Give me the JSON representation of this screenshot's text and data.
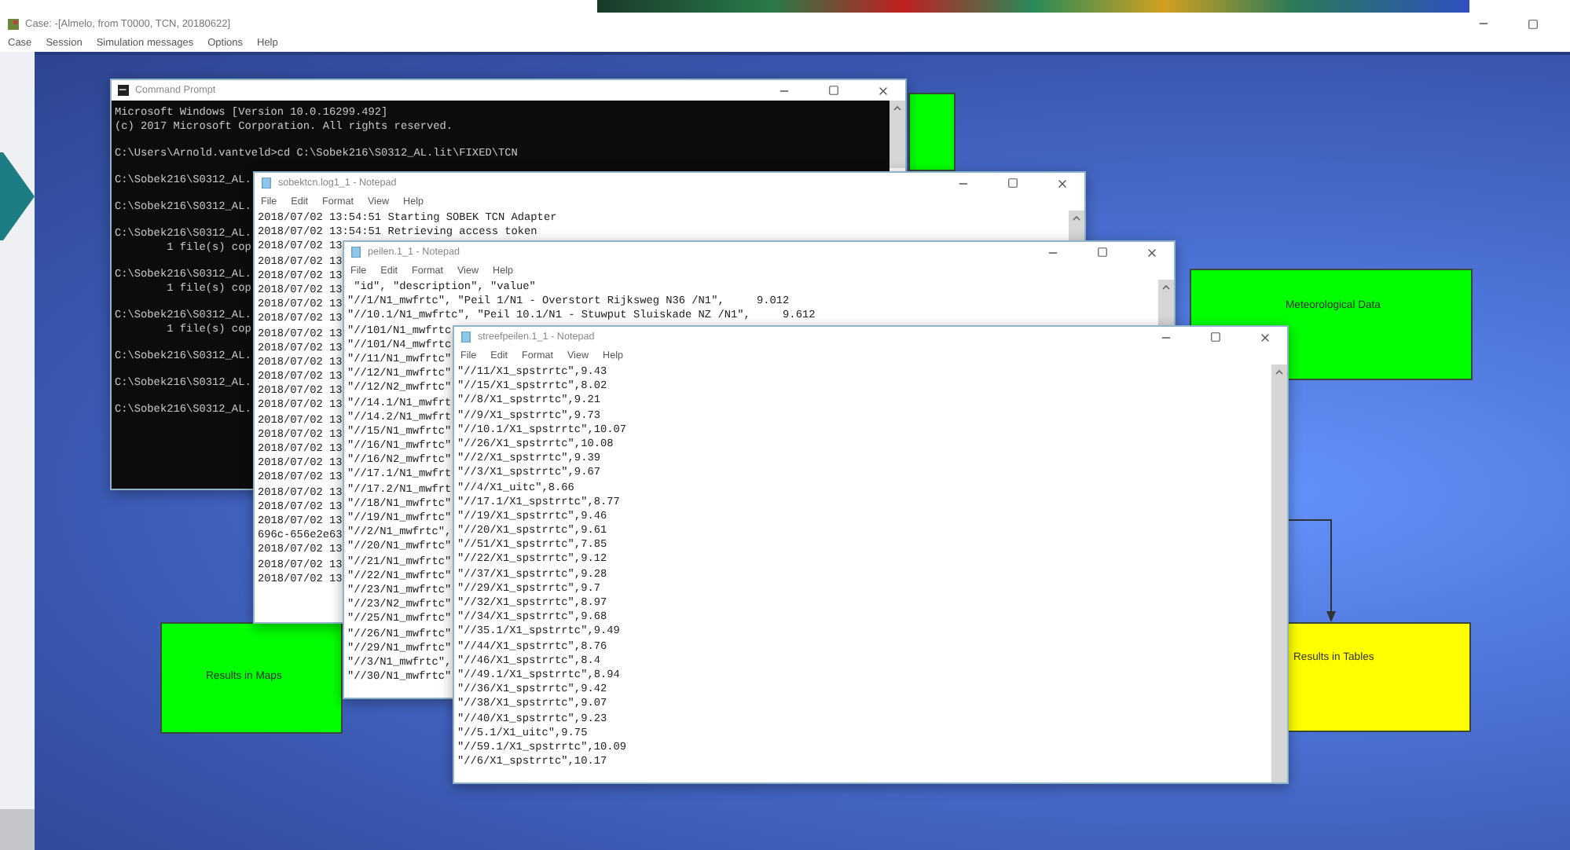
{
  "app": {
    "title": "Case: -[Almelo, from T0000, TCN, 20180622]",
    "menu": [
      "Case",
      "Session",
      "Simulation messages",
      "Options",
      "Help"
    ]
  },
  "canvas": {
    "nodes": [
      {
        "color": "#00ff00"
      },
      {
        "label": "Meteorological Data",
        "color": "#00ff00"
      },
      {
        "label": "Results in Maps",
        "color": "#00ff00"
      },
      {
        "label": "Results in Tables",
        "color": "#ffff00"
      }
    ]
  },
  "windows": [
    {
      "kind": "console",
      "title": "Command Prompt",
      "lines": [
        {
          "kind": "banner",
          "text": "Microsoft Windows [Version 10.0.16299.492]"
        },
        {
          "kind": "banner",
          "text": "(c) 2017 Microsoft Corporation. All rights reserved."
        },
        {
          "kind": "prompt",
          "text": "C:\\Users\\Arnold.vantveld>cd C:\\Sobek216\\S0312_AL.lit\\FIXED\\TCN"
        },
        {
          "kind": "prompt",
          "text": "C:\\Sobek216\\S0312_AL."
        },
        {
          "kind": "prompt",
          "text": "C:\\Sobek216\\S0312_AL."
        },
        {
          "kind": "prompt",
          "text": "C:\\Sobek216\\S0312_AL."
        },
        {
          "kind": "output",
          "text": "        1 file(s) cop"
        },
        {
          "kind": "prompt",
          "text": "C:\\Sobek216\\S0312_AL."
        },
        {
          "kind": "output",
          "text": "        1 file(s) cop"
        },
        {
          "kind": "prompt",
          "text": "C:\\Sobek216\\S0312_AL."
        },
        {
          "kind": "output",
          "text": "        1 file(s) cop"
        },
        {
          "kind": "prompt",
          "text": "C:\\Sobek216\\S0312_AL."
        },
        {
          "kind": "prompt",
          "text": "C:\\Sobek216\\S0312_AL."
        },
        {
          "kind": "prompt",
          "text": "C:\\Sobek216\\S0312_AL."
        }
      ]
    },
    {
      "kind": "notepad",
      "title": "sobektcn.log1_1 - Notepad",
      "menu": [
        "File",
        "Edit",
        "Format",
        "View",
        "Help"
      ],
      "lines": [
        "2018/07/02 13:54:51 Starting SOBEK TCN Adapter",
        "2018/07/02 13:54:51 Retrieving access token",
        "2018/07/02 13",
        "2018/07/02 13",
        "2018/07/02 13",
        "2018/07/02 13",
        "2018/07/02 13",
        "2018/07/02 13",
        "2018/07/02 13",
        "2018/07/02 13",
        "2018/07/02 13",
        "2018/07/02 13",
        "2018/07/02 13",
        "2018/07/02 13",
        "2018/07/02 13",
        "2018/07/02 13",
        "2018/07/02 13",
        "2018/07/02 13",
        "2018/07/02 13",
        "2018/07/02 13",
        "2018/07/02 13",
        "2018/07/02 13",
        "696c-656e2e63",
        "2018/07/02 13",
        "2018/07/02 13",
        "2018/07/02 13"
      ]
    },
    {
      "kind": "notepad",
      "title": "peilen.1_1 - Notepad",
      "menu": [
        "File",
        "Edit",
        "Format",
        "View",
        "Help"
      ],
      "lines": [
        " \"id\", \"description\", \"value\"",
        "\"//1/N1_mwfrtc\", \"Peil 1/N1 - Overstort Rijksweg N36 /N1\",     9.012",
        "\"//10.1/N1_mwfrtc\", \"Peil 10.1/N1 - Stuwput Sluiskade NZ /N1\",     9.612",
        "\"//101/N1_mwfrtc",
        "\"//101/N4_mwfrtc",
        "\"//11/N1_mwfrtc\"",
        "\"//12/N1_mwfrtc\"",
        "\"//12/N2_mwfrtc\"",
        "\"//14.1/N1_mwfrt",
        "\"//14.2/N1_mwfrt",
        "\"//15/N1_mwfrtc\"",
        "\"//16/N1_mwfrtc\"",
        "\"//16/N2_mwfrtc\"",
        "\"//17.1/N1_mwfrt",
        "\"//17.2/N1_mwfrt",
        "\"//18/N1_mwfrtc\"",
        "\"//19/N1_mwfrtc\"",
        "\"//2/N1_mwfrtc\",",
        "\"//20/N1_mwfrtc\"",
        "\"//21/N1_mwfrtc\"",
        "\"//22/N1_mwfrtc\"",
        "\"//23/N1_mwfrtc\"",
        "\"//23/N2_mwfrtc\"",
        "\"//25/N1_mwfrtc\"",
        "\"//26/N1_mwfrtc\"",
        "\"//29/N1_mwfrtc\"",
        "\"//3/N1_mwfrtc\",",
        "\"//30/N1_mwfrtc\""
      ]
    },
    {
      "kind": "notepad",
      "title": "streefpeilen.1_1 - Notepad",
      "menu": [
        "File",
        "Edit",
        "Format",
        "View",
        "Help"
      ],
      "lines": [
        "\"//11/X1_spstrrtc\",9.43",
        "\"//15/X1_spstrrtc\",8.02",
        "\"//8/X1_spstrrtc\",9.21",
        "\"//9/X1_spstrrtc\",9.73",
        "\"//10.1/X1_spstrrtc\",10.07",
        "\"//26/X1_spstrrtc\",10.08",
        "\"//2/X1_spstrrtc\",9.39",
        "\"//3/X1_spstrrtc\",9.67",
        "\"//4/X1_uitc\",8.66",
        "\"//17.1/X1_spstrrtc\",8.77",
        "\"//19/X1_spstrrtc\",9.46",
        "\"//20/X1_spstrrtc\",9.61",
        "\"//51/X1_spstrrtc\",7.85",
        "\"//22/X1_spstrrtc\",9.12",
        "\"//37/X1_spstrrtc\",9.28",
        "\"//29/X1_spstrrtc\",9.7",
        "\"//32/X1_spstrrtc\",8.97",
        "\"//34/X1_spstrrtc\",9.68",
        "\"//35.1/X1_spstrrtc\",9.49",
        "\"//44/X1_spstrrtc\",8.76",
        "\"//46/X1_spstrrtc\",8.4",
        "\"//49.1/X1_spstrrtc\",8.94",
        "\"//36/X1_spstrrtc\",9.42",
        "\"//38/X1_spstrrtc\",9.07",
        "\"//40/X1_spstrrtc\",9.23",
        "\"//5.1/X1_uitc\",9.75",
        "\"//59.1/X1_spstrrtc\",10.09",
        "\"//6/X1_spstrrtc\",10.17"
      ]
    }
  ]
}
